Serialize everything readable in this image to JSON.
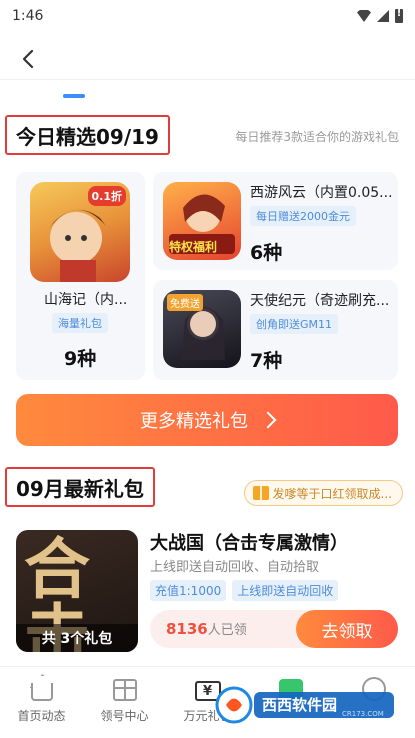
{
  "status_bar": {
    "time": "1:46"
  },
  "today": {
    "title": "今日精选09/19",
    "subtitle": "每日推荐3款适合你的游戏礼包",
    "games": [
      {
        "name": "山海记（内...",
        "tag": "海量礼包",
        "count": "9种",
        "badge": "0.1折"
      },
      {
        "name": "西游风云（内置0.05...",
        "tag": "每日赠送2000金元",
        "count": "6种",
        "badge": "特权福利"
      },
      {
        "name": "天使纪元（奇迹刷充...",
        "tag": "创角即送GM11",
        "count": "7种",
        "badge": "免费送"
      }
    ],
    "more_button": "更多精选礼包"
  },
  "monthly": {
    "title": "09月最新礼包",
    "tip": "发嗲等于口红领取成...",
    "featured": {
      "image_text": "合击",
      "pack_count": "共 3个礼包",
      "title": "大战国（合击专属激情）",
      "desc": "上线即送自动回收、自动拾取",
      "tags": [
        "充值1:1000",
        "上线即送自动回收"
      ],
      "claimed_number": "8136",
      "claimed_suffix": "人已领",
      "claim_button": "去领取"
    }
  },
  "bottom_nav": [
    {
      "label": "首页动态",
      "icon": "home-icon"
    },
    {
      "label": "领号中心",
      "icon": "gift-icon"
    },
    {
      "label": "万元礼包",
      "icon": "yen-ticket-icon"
    },
    {
      "label": "",
      "icon": "green-gift-icon"
    },
    {
      "label": "",
      "icon": "chat-icon"
    }
  ],
  "watermark": {
    "text": "西西软件园",
    "sub": "CR173.COM"
  },
  "colors": {
    "accent_orange": "#ff6a45",
    "highlight_red": "#e23b3b",
    "tag_blue": "#4f8cd9",
    "tab_blue": "#3d8bff"
  }
}
